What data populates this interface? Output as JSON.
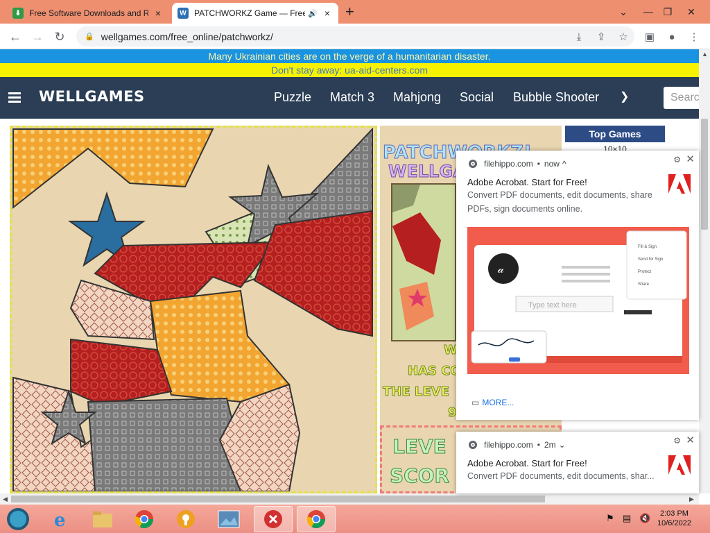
{
  "tabs": [
    {
      "title": "Free Software Downloads and Re",
      "favicon": "filehippo-icon",
      "close": "×"
    },
    {
      "title": "PATCHWORKZ Game — Free",
      "favicon": "wellgames-icon",
      "close": "×",
      "audio": "🔊"
    }
  ],
  "newtab_label": "+",
  "window_controls": {
    "dropdown": "⌄",
    "restore": "❐",
    "minimize": "—",
    "close": "✕"
  },
  "address": {
    "url": "wellgames.com/free_online/patchworkz/"
  },
  "banner": {
    "line1": "Many Ukrainian cities are on the verge of a humanitarian disaster.",
    "line2": "Don't stay away: ua-aid-centers.com",
    "colors": {
      "blue": "#1a93e0",
      "yellow": "#f7f200"
    }
  },
  "site": {
    "logo": "WELLGAMES",
    "nav": [
      "Puzzle",
      "Match 3",
      "Mahjong",
      "Social",
      "Bubble Shooter"
    ],
    "more_icon": "chevron-down-icon",
    "search_placeholder": "Searc"
  },
  "game": {
    "title_line1": "PATCHWORKZ!",
    "title_line2": "WELLGA",
    "text_lines": [
      "W",
      "HAS CO",
      "THE LEVE",
      "9"
    ],
    "level_label": "LEVE",
    "score_label": "SCOR"
  },
  "sidebar": {
    "top_games_title": "Top Games",
    "first_item": "10×10"
  },
  "notifications": [
    {
      "source": "filehippo.com",
      "time": "now",
      "expand": "^",
      "title": "Adobe Acrobat. Start for Free!",
      "body": "Convert PDF documents, edit documents, share PDFs, sign documents online.",
      "more": "MORE...",
      "image_texts": {
        "menu1": "Fill & Sign",
        "menu2": "Send for Sign",
        "menu3": "Protect",
        "menu4": "Share",
        "placeholder": "Type text here"
      }
    },
    {
      "source": "filehippo.com",
      "time": "2m",
      "expand": "⌄",
      "title": "Adobe Acrobat. Start for Free!",
      "body": "Convert PDF documents, edit documents, shar..."
    }
  ],
  "taskbar": {
    "apps": [
      "ie-icon",
      "file-explorer-icon",
      "chrome-icon",
      "vpn-icon",
      "photos-icon",
      "error-app-icon",
      "chrome-icon"
    ],
    "time": "2:03 PM",
    "date": "10/6/2022"
  }
}
